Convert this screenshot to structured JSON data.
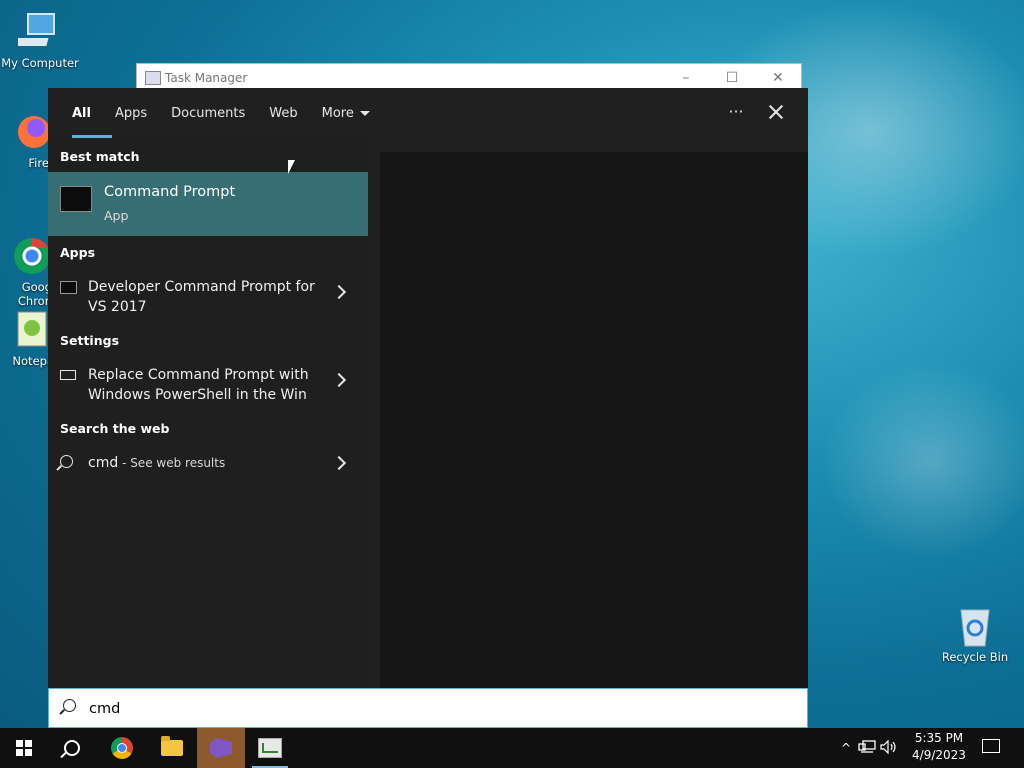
{
  "desktop": {
    "icons": [
      {
        "label": "My Computer",
        "icon": "computer-icon"
      },
      {
        "label": "Firefo",
        "icon": "firefox-icon"
      },
      {
        "label": "Goog\nChron",
        "icon": "chrome-icon"
      },
      {
        "label": "Notepa",
        "icon": "notepad-icon"
      },
      {
        "label": "Recycle Bin",
        "icon": "recycle-bin-icon"
      }
    ]
  },
  "task_manager": {
    "title": "Task Manager",
    "minimize": "–",
    "maximize": "☐",
    "close": "✕"
  },
  "search": {
    "tabs": [
      {
        "label": "All",
        "active": true
      },
      {
        "label": "Apps"
      },
      {
        "label": "Documents"
      },
      {
        "label": "Web"
      },
      {
        "label": "More"
      }
    ],
    "more_options": "···",
    "best_match_heading": "Best match",
    "best_match": {
      "name": "Command Prompt",
      "type": "App"
    },
    "apps_heading": "Apps",
    "apps": [
      {
        "label": "Developer Command Prompt for VS 2017"
      }
    ],
    "settings_heading": "Settings",
    "settings": [
      {
        "label": "Replace Command Prompt with Windows PowerShell in the Win"
      }
    ],
    "web_heading": "Search the web",
    "web": {
      "query": "cmd",
      "suffix": " - See web results"
    },
    "query": "cmd"
  },
  "taskbar": {
    "items": [
      "start-icon",
      "search-icon",
      "chrome-icon",
      "file-explorer-icon",
      "visual-studio-icon",
      "task-manager-icon"
    ],
    "time": "5:35 PM",
    "date": "4/9/2023",
    "accent": "#5fb2d6"
  }
}
